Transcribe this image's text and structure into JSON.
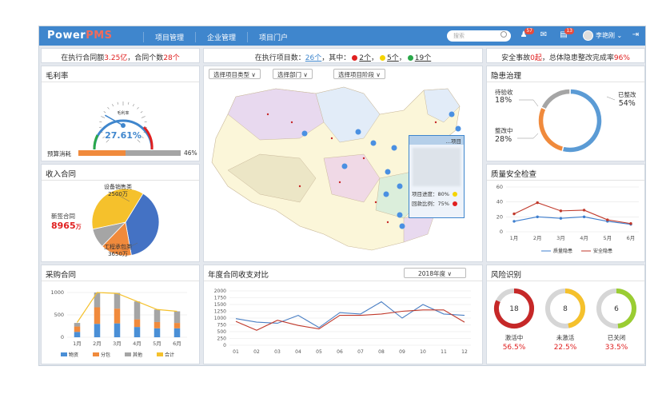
{
  "header": {
    "logo_a": "Power",
    "logo_b": "PMS",
    "nav": [
      "项目管理",
      "企业管理",
      "项目门户"
    ],
    "search_placeholder": "搜索",
    "badge1": "57",
    "badge2": "13",
    "user": "李艳刚 ⌄"
  },
  "kpi_left": {
    "t1": "在执行合同额",
    "v1": "3.25亿",
    "t2": "，合同个数",
    "v2": "28个"
  },
  "kpi_mid": {
    "t1": "在执行项目数：",
    "v1": "26个",
    "t2": "，其中：",
    "red": "2个",
    "yellow": "5个",
    "green": "19个"
  },
  "kpi_right": {
    "t1": "安全事故",
    "v1": "0起",
    "t2": "，总体隐患整改完成率",
    "v2": "96%"
  },
  "gross": {
    "title": "毛利率",
    "center_label": "毛利率",
    "value": "27.61%",
    "bar_label": "预算消耗",
    "bar_pct": "46%",
    "bar_fraction": 0.46,
    "gauge_fraction": 0.2761
  },
  "income": {
    "title": "收入合同",
    "new_label": "新签合同",
    "new_value": "8965",
    "unit": "万",
    "eq_label": "设备销售类",
    "eq_value": "2500万",
    "proj_label": "工程承包类",
    "proj_value": "3650万"
  },
  "map": {
    "filters": [
      "选择项目类型 ∨",
      "选择部门 ∨",
      "选择项目阶段 ∨"
    ],
    "tip_title": "…项目",
    "tip_rows": [
      "项目进度：80%",
      "回款比例：75%"
    ]
  },
  "hazard": {
    "title": "隐患治理",
    "pending": "待验收",
    "pending_pct": "18%",
    "done": "已整改",
    "done_pct": "54%",
    "fixing": "整改中",
    "fixing_pct": "28%"
  },
  "quality": {
    "title": "质量安全检查",
    "legend": [
      "质量隐患",
      "安全隐患"
    ]
  },
  "purchase": {
    "title": "采购合同",
    "legend": [
      "物资",
      "分包",
      "其他",
      "合计"
    ]
  },
  "annual": {
    "title": "年度合同收支对比",
    "year": "2018年度 ∨"
  },
  "risk": {
    "title": "风险识别",
    "items": [
      {
        "value": "18",
        "label": "激活中",
        "pct": "56.5%"
      },
      {
        "value": "8",
        "label": "未激活",
        "pct": "22.5%"
      },
      {
        "value": "6",
        "label": "已关闭",
        "pct": "33.5%"
      }
    ]
  },
  "colors": {
    "blue": "#3f86cd",
    "red": "#e02020",
    "orange": "#f08a3c",
    "gray": "#a5a5a5",
    "yellow": "#f5c12c"
  },
  "chart_data": [
    {
      "type": "pie",
      "title": "收入合同",
      "slices": [
        {
          "name": "新签合同",
          "value": 8965
        },
        {
          "name": "设备销售类",
          "value": 2500
        },
        {
          "name": "工程承包类",
          "value": 3650
        }
      ]
    },
    {
      "type": "pie",
      "title": "隐患治理",
      "slices": [
        {
          "name": "已整改",
          "value": 54
        },
        {
          "name": "整改中",
          "value": 28
        },
        {
          "name": "待验收",
          "value": 18
        }
      ]
    },
    {
      "type": "line",
      "title": "质量安全检查",
      "categories": [
        "1月",
        "2月",
        "3月",
        "4月",
        "5月",
        "6月"
      ],
      "ylim": [
        0,
        60
      ],
      "yticks": [
        0,
        20,
        40,
        60
      ],
      "series": [
        {
          "name": "质量隐患",
          "values": [
            14,
            20,
            18,
            20,
            14,
            10
          ]
        },
        {
          "name": "安全隐患",
          "values": [
            24,
            39,
            28,
            29,
            16,
            11
          ]
        }
      ]
    },
    {
      "type": "bar",
      "title": "采购合同",
      "categories": [
        "1月",
        "2月",
        "3月",
        "4月",
        "5月",
        "6月"
      ],
      "ylim": [
        0,
        1000
      ],
      "yticks": [
        0,
        500,
        1000
      ],
      "series": [
        {
          "name": "物资",
          "values": [
            120,
            300,
            310,
            230,
            200,
            200
          ]
        },
        {
          "name": "分包",
          "values": [
            120,
            370,
            330,
            170,
            140,
            120
          ]
        },
        {
          "name": "其他",
          "values": [
            80,
            330,
            350,
            400,
            280,
            260
          ]
        },
        {
          "name": "合计",
          "values": [
            330,
            1000,
            980,
            800,
            620,
            580
          ]
        }
      ]
    },
    {
      "type": "line",
      "title": "年度合同收支对比",
      "categories": [
        "01",
        "02",
        "03",
        "04",
        "05",
        "06",
        "07",
        "08",
        "09",
        "10",
        "11",
        "12"
      ],
      "ylim": [
        0,
        2000
      ],
      "yticks": [
        0,
        250,
        500,
        750,
        1000,
        1250,
        1500,
        1750,
        2000
      ],
      "series": [
        {
          "values": [
            980,
            850,
            810,
            1100,
            650,
            1200,
            1150,
            1600,
            1000,
            1500,
            1150,
            1100
          ]
        },
        {
          "values": [
            880,
            550,
            920,
            730,
            600,
            1100,
            1100,
            1150,
            1250,
            1300,
            1300,
            850
          ]
        }
      ]
    }
  ]
}
